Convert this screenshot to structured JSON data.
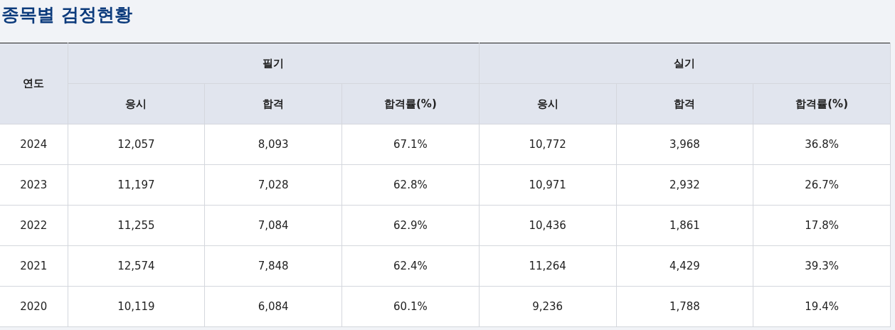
{
  "title": "종목별 검정현황",
  "table": {
    "year_header": "연도",
    "groups": [
      {
        "label": "필기",
        "columns": [
          "응시",
          "합격",
          "합격률(%)"
        ]
      },
      {
        "label": "실기",
        "columns": [
          "응시",
          "합격",
          "합격률(%)"
        ]
      }
    ],
    "rows": [
      {
        "year": "2024",
        "cells": [
          "12,057",
          "8,093",
          "67.1%",
          "10,772",
          "3,968",
          "36.8%"
        ]
      },
      {
        "year": "2023",
        "cells": [
          "11,197",
          "7,028",
          "62.8%",
          "10,971",
          "2,932",
          "26.7%"
        ]
      },
      {
        "year": "2022",
        "cells": [
          "11,255",
          "7,084",
          "62.9%",
          "10,436",
          "1,861",
          "17.8%"
        ]
      },
      {
        "year": "2021",
        "cells": [
          "12,574",
          "7,848",
          "62.4%",
          "11,264",
          "4,429",
          "39.3%"
        ]
      },
      {
        "year": "2020",
        "cells": [
          "10,119",
          "6,084",
          "60.1%",
          "9,236",
          "1,788",
          "19.4%"
        ]
      }
    ]
  }
}
